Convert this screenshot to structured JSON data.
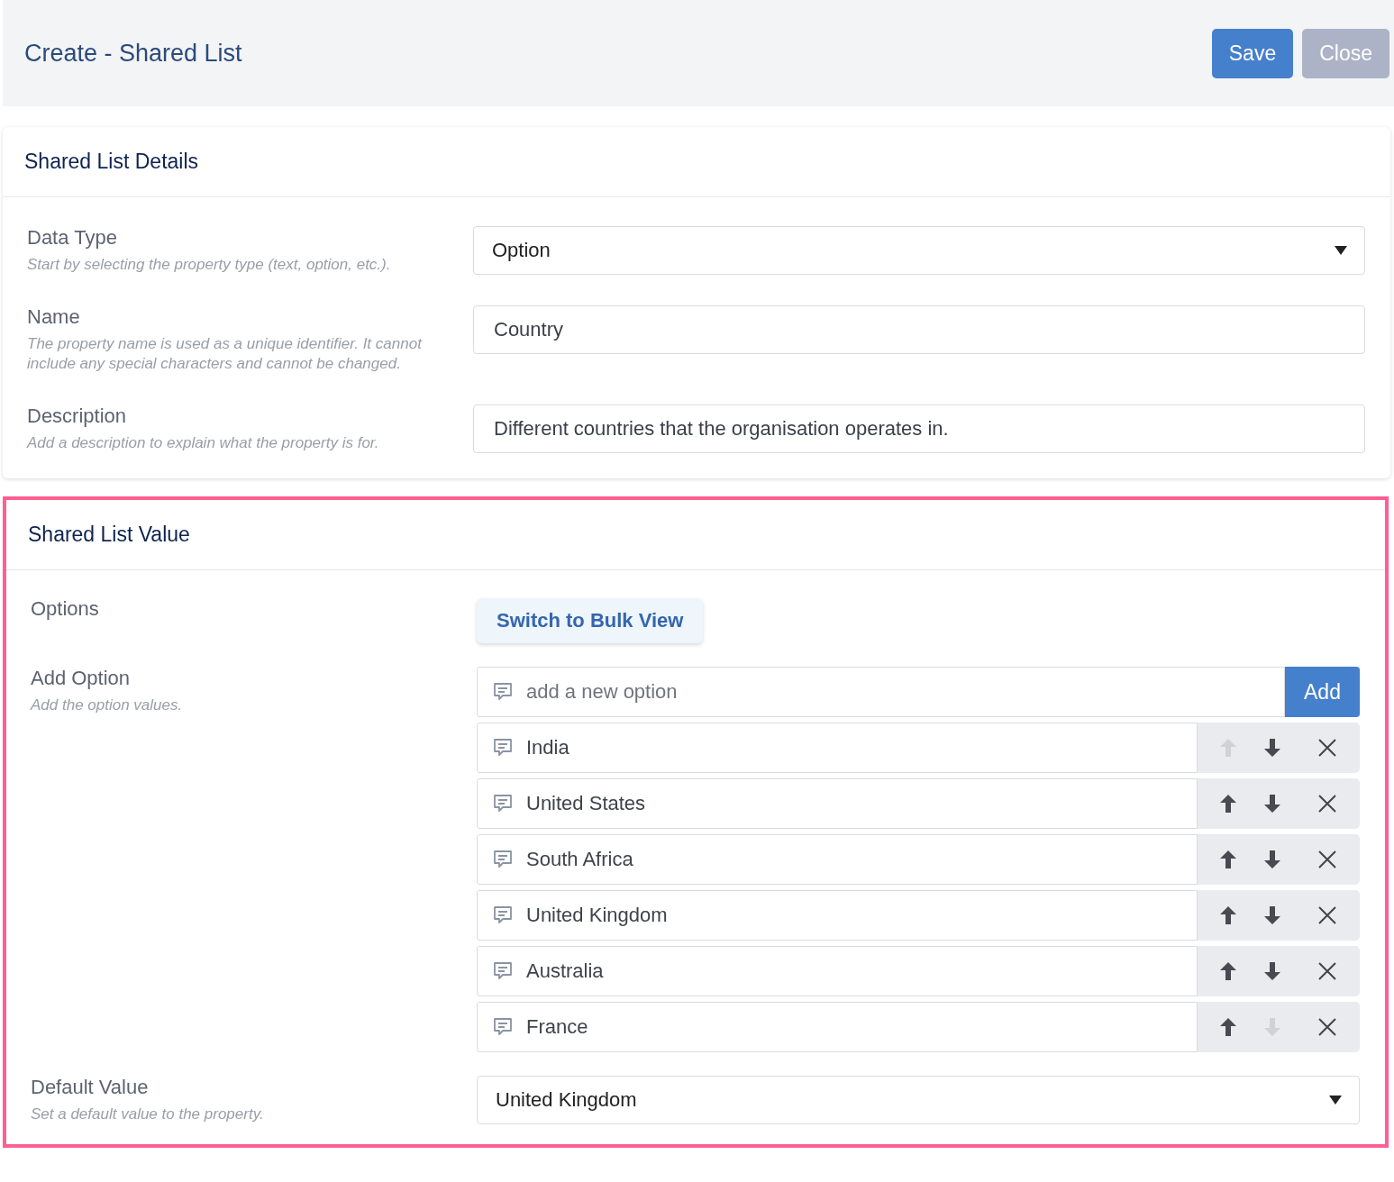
{
  "header": {
    "title": "Create - Shared List",
    "buttons": [
      {
        "label": "Save",
        "disabled": false
      },
      {
        "label": "Close",
        "disabled": true
      }
    ]
  },
  "details": {
    "title": "Shared List Details",
    "fields": [
      {
        "kind": "select",
        "label": "Data Type",
        "help": "Start by selecting the property type (text, option, etc.).",
        "value": "Option"
      },
      {
        "kind": "text",
        "label": "Name",
        "help": "The property name is used as a unique identifier. It cannot include any special characters and cannot be changed.",
        "value": "Country"
      },
      {
        "kind": "text",
        "label": "Description",
        "help": "Add a description to explain what the property is for.",
        "value": "Different countries that the organisation operates in."
      }
    ]
  },
  "values": {
    "title": "Shared List Value",
    "options_label": "Options",
    "bulk_button": "Switch to Bulk View",
    "add": {
      "label": "Add Option",
      "help": "Add the option values.",
      "placeholder": "add a new option",
      "button": "Add"
    },
    "items": [
      {
        "value": "India",
        "up_disabled": true,
        "down_disabled": false
      },
      {
        "value": "United States",
        "up_disabled": false,
        "down_disabled": false
      },
      {
        "value": "South Africa",
        "up_disabled": false,
        "down_disabled": false
      },
      {
        "value": "United Kingdom",
        "up_disabled": false,
        "down_disabled": false
      },
      {
        "value": "Australia",
        "up_disabled": false,
        "down_disabled": false
      },
      {
        "value": "France",
        "up_disabled": false,
        "down_disabled": true
      }
    ],
    "default": {
      "label": "Default Value",
      "help": "Set a default value to the property.",
      "value": "United Kingdom"
    }
  }
}
